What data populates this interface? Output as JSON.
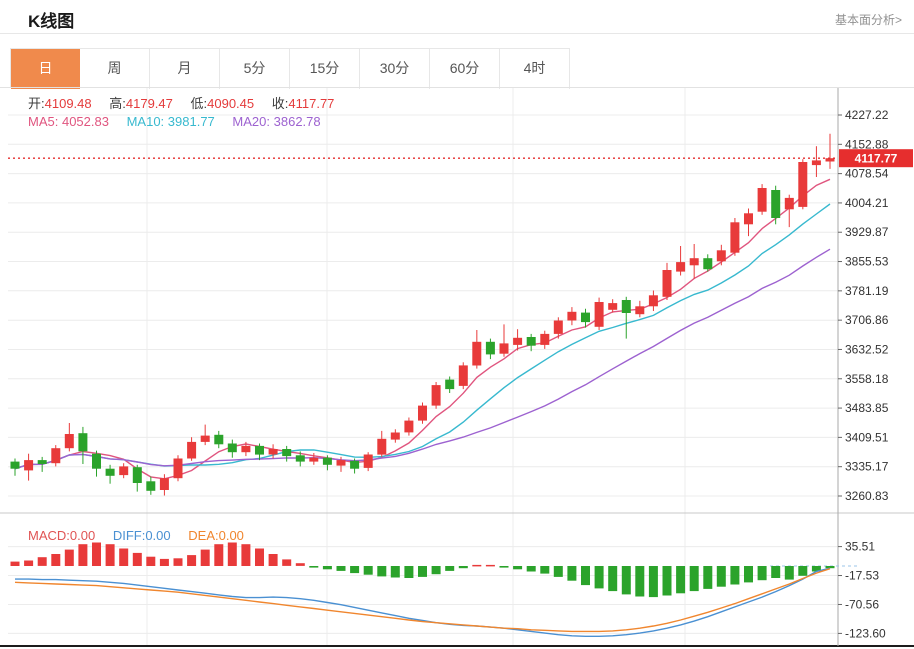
{
  "header": {
    "title": "K线图",
    "link": "基本面分析>"
  },
  "tabs": {
    "items": [
      {
        "label": "日",
        "active": true
      },
      {
        "label": "周",
        "active": false
      },
      {
        "label": "月",
        "active": false
      },
      {
        "label": "5分",
        "active": false
      },
      {
        "label": "15分",
        "active": false
      },
      {
        "label": "30分",
        "active": false
      },
      {
        "label": "60分",
        "active": false
      },
      {
        "label": "4时",
        "active": false
      }
    ]
  },
  "legend": {
    "ohlc": [
      {
        "label": "开:",
        "value": "4109.48"
      },
      {
        "label": "高:",
        "value": "4179.47"
      },
      {
        "label": "低:",
        "value": "4090.45"
      },
      {
        "label": "收:",
        "value": "4117.77"
      }
    ],
    "ma": [
      {
        "label": "MA5:",
        "value": "4052.83"
      },
      {
        "label": "MA10:",
        "value": "3981.77"
      },
      {
        "label": "MA20:",
        "value": "3862.78"
      }
    ],
    "macd": [
      {
        "label": "MACD:",
        "value": "0.00"
      },
      {
        "label": "DIFF:",
        "value": "0.00"
      },
      {
        "label": "DEA:",
        "value": "0.00"
      }
    ]
  },
  "price_tag": "4117.77",
  "colors": {
    "up": "#e83a3a",
    "down": "#2ba32b",
    "accent_tab": "#f08a4c",
    "ma5": "#e0557f",
    "ma10": "#38b9cf",
    "ma20": "#9d62d0",
    "diff": "#4a90d2",
    "dea": "#f0862e",
    "price_line": "#e62e2e",
    "tag_bg": "#e62e2e",
    "grid": "#ececec",
    "axis": "#aaaaaa"
  },
  "chart_data": {
    "type": "candlestick",
    "title": "K线图",
    "main": {
      "y_ticks": [
        "4227.22",
        "4152.88",
        "4078.54",
        "4004.21",
        "3929.87",
        "3855.53",
        "3781.19",
        "3706.86",
        "3632.52",
        "3558.18",
        "3483.85",
        "3409.51",
        "3335.17",
        "3260.83"
      ],
      "ylim": [
        3260.83,
        4227.22
      ],
      "current_price": 4117.77,
      "ma_periods": [
        5,
        10,
        20
      ],
      "candles_ohlc": [
        [
          3348,
          3356,
          3312,
          3330
        ],
        [
          3326,
          3368,
          3300,
          3352
        ],
        [
          3352,
          3360,
          3322,
          3342
        ],
        [
          3344,
          3390,
          3336,
          3382
        ],
        [
          3382,
          3446,
          3374,
          3418
        ],
        [
          3420,
          3436,
          3342,
          3374
        ],
        [
          3368,
          3376,
          3310,
          3330
        ],
        [
          3330,
          3340,
          3292,
          3312
        ],
        [
          3314,
          3344,
          3306,
          3336
        ],
        [
          3334,
          3340,
          3272,
          3294
        ],
        [
          3298,
          3310,
          3264,
          3274
        ],
        [
          3276,
          3316,
          3262,
          3306
        ],
        [
          3306,
          3364,
          3298,
          3356
        ],
        [
          3356,
          3410,
          3350,
          3398
        ],
        [
          3398,
          3442,
          3390,
          3414
        ],
        [
          3416,
          3426,
          3382,
          3392
        ],
        [
          3394,
          3404,
          3358,
          3372
        ],
        [
          3372,
          3398,
          3362,
          3388
        ],
        [
          3388,
          3394,
          3352,
          3366
        ],
        [
          3366,
          3392,
          3356,
          3380
        ],
        [
          3380,
          3388,
          3348,
          3362
        ],
        [
          3364,
          3374,
          3336,
          3348
        ],
        [
          3348,
          3370,
          3340,
          3358
        ],
        [
          3358,
          3364,
          3326,
          3340
        ],
        [
          3338,
          3360,
          3322,
          3352
        ],
        [
          3350,
          3356,
          3318,
          3330
        ],
        [
          3332,
          3372,
          3324,
          3366
        ],
        [
          3366,
          3426,
          3360,
          3406
        ],
        [
          3404,
          3430,
          3396,
          3422
        ],
        [
          3422,
          3460,
          3414,
          3452
        ],
        [
          3452,
          3498,
          3444,
          3490
        ],
        [
          3490,
          3550,
          3482,
          3542
        ],
        [
          3556,
          3564,
          3522,
          3532
        ],
        [
          3540,
          3600,
          3532,
          3592
        ],
        [
          3592,
          3682,
          3584,
          3652
        ],
        [
          3652,
          3660,
          3608,
          3620
        ],
        [
          3622,
          3696,
          3614,
          3648
        ],
        [
          3644,
          3684,
          3630,
          3662
        ],
        [
          3664,
          3672,
          3628,
          3642
        ],
        [
          3644,
          3680,
          3634,
          3672
        ],
        [
          3672,
          3714,
          3660,
          3706
        ],
        [
          3706,
          3740,
          3694,
          3728
        ],
        [
          3726,
          3736,
          3688,
          3702
        ],
        [
          3690,
          3764,
          3682,
          3753
        ],
        [
          3733,
          3760,
          3726,
          3750
        ],
        [
          3758,
          3766,
          3660,
          3725
        ],
        [
          3722,
          3756,
          3714,
          3742
        ],
        [
          3742,
          3782,
          3730,
          3770
        ],
        [
          3766,
          3852,
          3758,
          3834
        ],
        [
          3830,
          3895,
          3820,
          3854
        ],
        [
          3846,
          3900,
          3812,
          3864
        ],
        [
          3864,
          3874,
          3830,
          3836
        ],
        [
          3856,
          3898,
          3846,
          3884
        ],
        [
          3878,
          3966,
          3870,
          3955
        ],
        [
          3950,
          3990,
          3920,
          3978
        ],
        [
          3982,
          4052,
          3974,
          4042
        ],
        [
          4037,
          4048,
          3950,
          3966
        ],
        [
          3988,
          4025,
          3943,
          4017
        ],
        [
          3994,
          4115,
          3988,
          4108
        ],
        [
          4100,
          4148,
          4070,
          4112
        ],
        [
          4109.48,
          4179.47,
          4090.45,
          4117.77
        ]
      ]
    },
    "macd": {
      "y_ticks": [
        "35.51",
        "-17.53",
        "-70.56",
        "-123.60"
      ],
      "ylim": [
        -123.6,
        35.51
      ],
      "hist": [
        8,
        10,
        16,
        22,
        30,
        40,
        43,
        40,
        32,
        24,
        17,
        13,
        14,
        20,
        30,
        40,
        43,
        40,
        32,
        22,
        12,
        5,
        -3,
        -6,
        -9,
        -13,
        -16,
        -19,
        -21,
        -22,
        -20,
        -15,
        -9,
        -4,
        2,
        2,
        -3,
        -6,
        -10,
        -14,
        -20,
        -27,
        -35,
        -41,
        -46,
        -52,
        -56,
        -57,
        -54,
        -50,
        -46,
        -42,
        -38,
        -34,
        -30,
        -26,
        -22,
        -25,
        -18,
        -10,
        -4
      ],
      "diff": [
        -24,
        -24,
        -25,
        -25,
        -26,
        -27,
        -28,
        -30,
        -32,
        -35,
        -38,
        -41,
        -44,
        -47,
        -50,
        -53,
        -56,
        -58,
        -58,
        -57,
        -58,
        -60,
        -63,
        -67,
        -71,
        -76,
        -81,
        -86,
        -91,
        -96,
        -100,
        -104,
        -107,
        -109,
        -110,
        -112,
        -114,
        -117,
        -120,
        -123,
        -126,
        -128,
        -129,
        -129,
        -128,
        -126,
        -123,
        -119,
        -114,
        -108,
        -101,
        -93,
        -84,
        -75,
        -66,
        -57,
        -47,
        -36,
        -24,
        -10,
        -4
      ],
      "dea": [
        -30,
        -31,
        -32,
        -33,
        -34,
        -35,
        -36,
        -38,
        -40,
        -42,
        -44,
        -46,
        -48,
        -51,
        -54,
        -57,
        -60,
        -63,
        -66,
        -69,
        -72,
        -75,
        -78,
        -81,
        -84,
        -87,
        -90,
        -93,
        -96,
        -99,
        -102,
        -104,
        -106,
        -108,
        -110,
        -112,
        -114,
        -115,
        -117,
        -118,
        -119,
        -120,
        -120,
        -120,
        -119,
        -117,
        -114,
        -110,
        -105,
        -99,
        -92,
        -85,
        -77,
        -69,
        -60,
        -51,
        -42,
        -33,
        -23,
        -13,
        -5
      ]
    }
  }
}
